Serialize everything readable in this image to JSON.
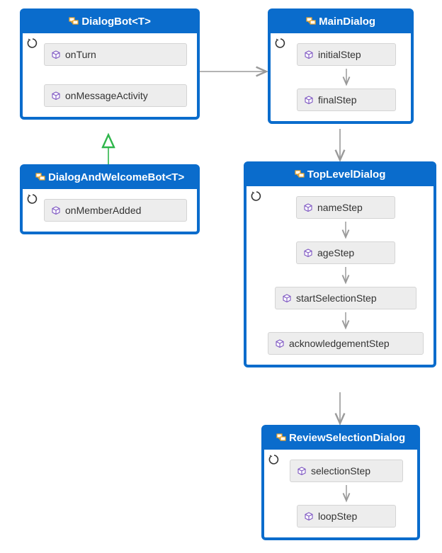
{
  "nodes": {
    "dialogBot": {
      "title": "DialogBot<T>",
      "methods": [
        "onTurn",
        "onMessageActivity"
      ]
    },
    "dialogAndWelcomeBot": {
      "title": "DialogAndWelcomeBot<T>",
      "methods": [
        "onMemberAdded"
      ]
    },
    "mainDialog": {
      "title": "MainDialog",
      "methods": [
        "initialStep",
        "finalStep"
      ]
    },
    "topLevelDialog": {
      "title": "TopLevelDialog",
      "methods": [
        "nameStep",
        "ageStep",
        "startSelectionStep",
        "acknowledgementStep"
      ]
    },
    "reviewSelectionDialog": {
      "title": "ReviewSelectionDialog",
      "methods": [
        "selectionStep",
        "loopStep"
      ]
    }
  },
  "edges": [
    {
      "from": "dialogAndWelcomeBot",
      "to": "dialogBot",
      "type": "inherit"
    },
    {
      "from": "dialogBot",
      "to": "mainDialog",
      "type": "arrow"
    },
    {
      "from": "mainDialog",
      "to": "topLevelDialog",
      "type": "arrow"
    },
    {
      "from": "topLevelDialog",
      "to": "reviewSelectionDialog",
      "type": "arrow"
    }
  ],
  "colors": {
    "border": "#0a6ccc",
    "method_bg": "#ededed",
    "arrow": "#9a9a9a",
    "inherit": "#2fb64b",
    "cube": "#7e57c2"
  }
}
